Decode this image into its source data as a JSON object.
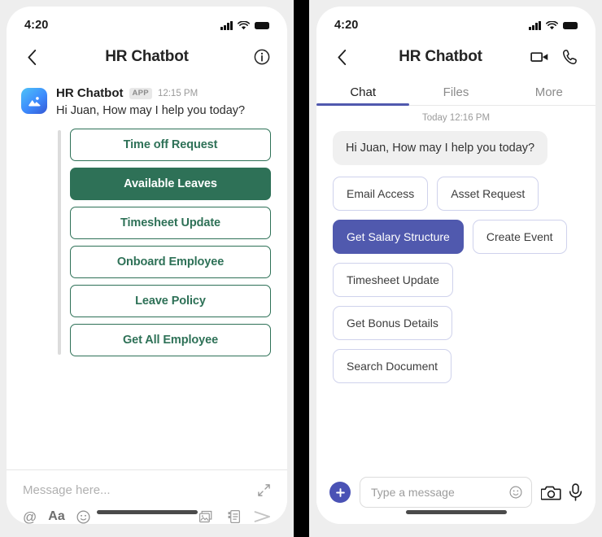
{
  "colors": {
    "green": "#2E7157",
    "purple": "#5059AE",
    "purple_plus": "#4A52B5",
    "page_bg": "#EEEEEE",
    "bubble_bg": "#F0F0F0",
    "divider": "#E8E8E8"
  },
  "left_phone": {
    "status": {
      "time": "4:20",
      "signal_icon": "signal-bars-icon",
      "wifi_icon": "wifi-icon",
      "battery_icon": "battery-icon"
    },
    "header": {
      "back_icon": "chevron-left-icon",
      "title": "HR Chatbot",
      "info_icon": "info-circle-icon"
    },
    "message": {
      "avatar_icon": "app-avatar-image-icon",
      "sender": "HR Chatbot",
      "badge": "APP",
      "time": "12:15 PM",
      "text": "Hi Juan, How may I help you today?"
    },
    "suggestions": [
      {
        "label": "Time off Request",
        "selected": false
      },
      {
        "label": "Available Leaves",
        "selected": true
      },
      {
        "label": "Timesheet Update",
        "selected": false
      },
      {
        "label": "Onboard Employee",
        "selected": false
      },
      {
        "label": "Leave Policy",
        "selected": false
      },
      {
        "label": "Get All Employee",
        "selected": false
      }
    ],
    "composer": {
      "placeholder": "Message here...",
      "expand_icon": "expand-arrows-icon",
      "mention_icon": "@",
      "format_icon": "Aa",
      "emoji_icon": "emoji-smiley-icon",
      "image_icon": "image-gallery-icon",
      "list_icon": "checklist-icon",
      "send_icon": "send-arrow-icon"
    }
  },
  "right_phone": {
    "status": {
      "time": "4:20",
      "signal_icon": "signal-bars-icon",
      "wifi_icon": "wifi-icon",
      "battery_icon": "battery-icon"
    },
    "header": {
      "back_icon": "chevron-left-icon",
      "title": "HR Chatbot",
      "video_icon": "video-camera-icon",
      "call_icon": "phone-handset-icon"
    },
    "tabs": [
      {
        "label": "Chat",
        "active": true
      },
      {
        "label": "Files",
        "active": false
      },
      {
        "label": "More",
        "active": false
      }
    ],
    "daystamp": "Today 12:16 PM",
    "bubble_text": "Hi Juan, How may I help you today?",
    "chips": [
      {
        "label": "Email Access",
        "selected": false
      },
      {
        "label": "Asset Request",
        "selected": false
      },
      {
        "label": "Get Salary Structure",
        "selected": true
      },
      {
        "label": "Create Event",
        "selected": false
      },
      {
        "label": "Timesheet Update",
        "selected": false
      },
      {
        "label": "Get Bonus Details",
        "selected": false
      },
      {
        "label": "Search Document",
        "selected": false
      }
    ],
    "composer": {
      "plus_icon": "plus-icon",
      "placeholder": "Type a message",
      "emoji_icon": "emoji-smiley-icon",
      "camera_icon": "camera-icon",
      "mic_icon": "microphone-icon"
    }
  }
}
